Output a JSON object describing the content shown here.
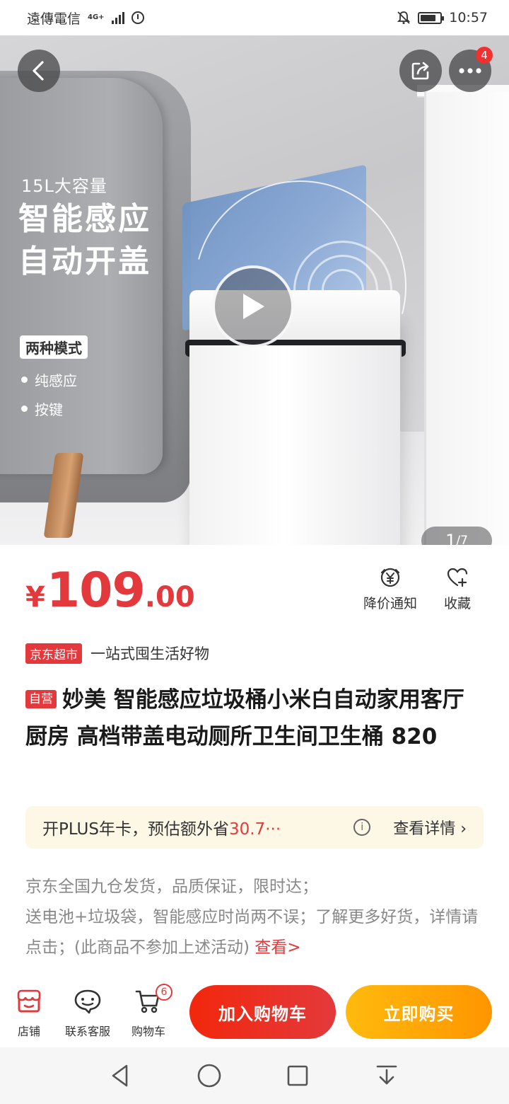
{
  "status_bar": {
    "carrier": "遠傳電信",
    "network": "4G+",
    "time": "10:57"
  },
  "gallery": {
    "promo_capacity": "15L大容量",
    "promo_headline_line1": "智能感应",
    "promo_headline_line2": "自动开盖",
    "promo_modes_tag": "两种模式",
    "promo_mode_1": "纯感应",
    "promo_mode_2": "按键",
    "page_current": "1",
    "page_total": "/7",
    "more_badge_count": "4"
  },
  "price": {
    "currency": "¥",
    "integer": "109",
    "decimal": ".00",
    "notify_label": "降价通知",
    "favorite_label": "收藏"
  },
  "store": {
    "tag": "京东超市",
    "slogan": "一站式囤生活好物"
  },
  "product": {
    "self_operated_tag": "自营",
    "title": "妙美 智能感应垃圾桶小米白自动家用客厅厨房 高档带盖电动厕所卫生间卫生桶 820"
  },
  "plus_bar": {
    "text_prefix": "开PLUS年卡，预估额外省",
    "amount": "30.7···",
    "info_symbol": "i",
    "detail_label": "查看详情 ›"
  },
  "description": {
    "line1": "京东全国九仓发货，品质保证，限时达；",
    "line2": "送电池+垃圾袋，智能感应时尚两不误；了解更多好货，详情请点击；(此商品不参加上述活动) ",
    "link_label": "查看>"
  },
  "action_bar": {
    "store_label": "店铺",
    "service_label": "联系客服",
    "cart_label": "购物车",
    "cart_count": "6",
    "add_to_cart_label": "加入购物车",
    "buy_now_label": "立即购买"
  },
  "colors": {
    "jd_red": "#e4393c",
    "buy_orange": "#ff9500",
    "plus_bg": "#fdf7e6"
  },
  "icons": [
    "back-arrow-icon",
    "share-icon",
    "more-icon",
    "play-icon",
    "yen-bell-icon",
    "heart-plus-icon",
    "store-icon",
    "chat-icon",
    "cart-icon"
  ]
}
